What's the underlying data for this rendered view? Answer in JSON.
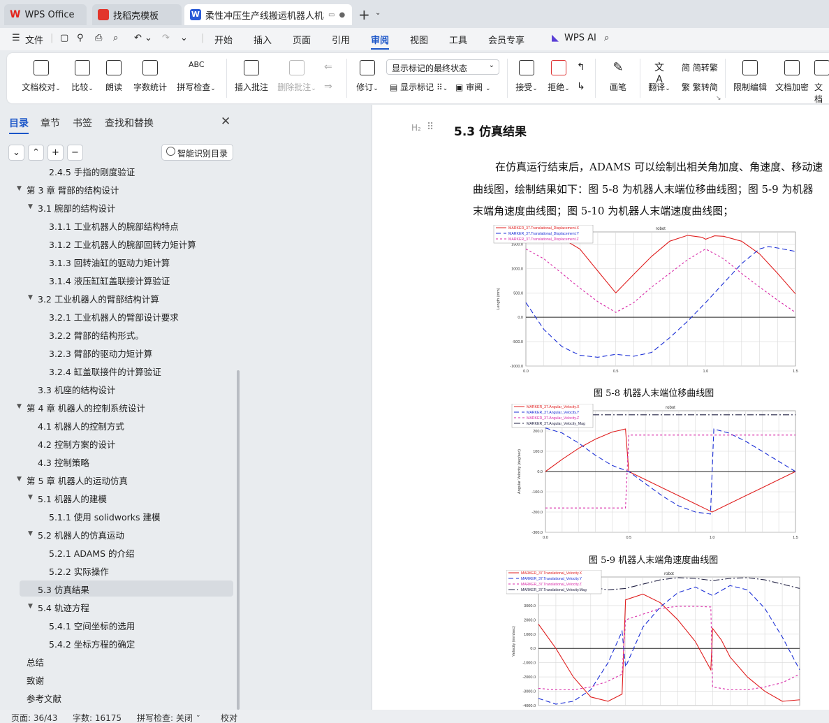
{
  "tabs": {
    "wps": "WPS Office",
    "daoke": "找稻壳模板",
    "doc": "柔性冲压生产线搬运机器人机械"
  },
  "menu": {
    "file": "文件",
    "items": [
      "开始",
      "插入",
      "页面",
      "引用",
      "审阅",
      "视图",
      "工具",
      "会员专享"
    ],
    "active": "审阅",
    "ai": "WPS AI"
  },
  "ribbon": {
    "proof": "文档校对",
    "compare": "比较",
    "read": "朗读",
    "wordcount": "字数统计",
    "spell": "拼写检查",
    "insert_comment": "插入批注",
    "delete_comment": "删除批注",
    "revise": "修订",
    "show_markup_select": "显示标记的最终状态",
    "show_markup": "显示标记",
    "review": "审阅",
    "accept": "接受",
    "reject": "拒绝",
    "pen": "画笔",
    "translate": "翻译",
    "to_trad": "简转繁",
    "to_simp": "繁转简",
    "restrict": "限制编辑",
    "encrypt": "文档加密",
    "more": "文档"
  },
  "sidebar": {
    "tabs": [
      "目录",
      "章节",
      "书签",
      "查找和替换"
    ],
    "smart_toc": "智能识别目录",
    "toc": [
      {
        "text": "2.4.5 手指的刚度验证",
        "level": 3,
        "tri": false
      },
      {
        "text": "第 3 章   臂部的结构设计",
        "level": 1,
        "tri": true
      },
      {
        "text": "3.1 腕部的结构设计",
        "level": 2,
        "tri": true
      },
      {
        "text": "3.1.1 工业机器人的腕部结构特点",
        "level": 3,
        "tri": false
      },
      {
        "text": "3.1.2 工业机器人的腕部回转力矩计算",
        "level": 3,
        "tri": false
      },
      {
        "text": "3.1.3  回转油缸的驱动力矩计算",
        "level": 3,
        "tri": false
      },
      {
        "text": "3.1.4  液压缸缸盖联接计算验证",
        "level": 3,
        "tri": false
      },
      {
        "text": "3.2  工业机器人的臂部结构计算",
        "level": 2,
        "tri": true
      },
      {
        "text": "3.2.1 工业机器人的臂部设计要求",
        "level": 3,
        "tri": false
      },
      {
        "text": "3.2.2 臂部的结构形式。",
        "level": 3,
        "tri": false
      },
      {
        "text": "3.2.3 臂部的驱动力矩计算",
        "level": 3,
        "tri": false
      },
      {
        "text": "3.2.4 缸盖联接件的计算验证",
        "level": 3,
        "tri": false
      },
      {
        "text": "3.3  机座的结构设计",
        "level": 2,
        "tri": false
      },
      {
        "text": "第 4 章   机器人的控制系统设计",
        "level": 1,
        "tri": true
      },
      {
        "text": "4.1 机器人的控制方式",
        "level": 2,
        "tri": false
      },
      {
        "text": "4.2 控制方案的设计",
        "level": 2,
        "tri": false
      },
      {
        "text": "4.3 控制策略",
        "level": 2,
        "tri": false
      },
      {
        "text": "第 5 章    机器人的运动仿真",
        "level": 1,
        "tri": true
      },
      {
        "text": "5.1 机器人的建模",
        "level": 2,
        "tri": true
      },
      {
        "text": "5.1.1  使用 solidworks 建模",
        "level": 3,
        "tri": false
      },
      {
        "text": "5.2  机器人的仿真运动",
        "level": 2,
        "tri": true
      },
      {
        "text": "5.2.1 ADAMS 的介绍",
        "level": 3,
        "tri": false
      },
      {
        "text": "5.2.2 实际操作",
        "level": 3,
        "tri": false
      },
      {
        "text": "5.3  仿真结果",
        "level": 2,
        "tri": false,
        "selected": true
      },
      {
        "text": "5.4  轨迹方程",
        "level": 2,
        "tri": true
      },
      {
        "text": "5.4.1 空间坐标的选用",
        "level": 3,
        "tri": false
      },
      {
        "text": "5.4.2 坐标方程的确定",
        "level": 3,
        "tri": false
      },
      {
        "text": "总结",
        "level": 1,
        "tri": false
      },
      {
        "text": "致谢",
        "level": 1,
        "tri": false
      },
      {
        "text": "参考文献",
        "level": 1,
        "tri": false
      }
    ]
  },
  "doc": {
    "heading_marker": "H₂",
    "heading": "5.3  仿真结果",
    "para": [
      "在仿真运行结束后，ADAMS 可以绘制出相关角加度、角速度、移动速",
      "曲线图，绘制结果如下：图 5-8 为机器人末端位移曲线图；图 5-9 为机器",
      "末端角速度曲线图；图 5-10 为机器人末端速度曲线图；"
    ],
    "cap1": "图 5-8  机器人末端位移曲线图",
    "cap2": "图 5-9  机器人末端角速度曲线图"
  },
  "status": {
    "page": "页面: 36/43",
    "words": "字数: 16175",
    "spell": "拼写检查: 关闭",
    "proof": "校对"
  },
  "chart_data": [
    {
      "type": "line",
      "title": "robot",
      "ylabel": "Length (mm)",
      "xlim": [
        0,
        1.5
      ],
      "ylim": [
        -1000,
        1750
      ],
      "xticks": [
        "0.0",
        "0.5",
        "1.0",
        "1.5"
      ],
      "yticks": [
        "-1000.0",
        "-500.0",
        "0.0",
        "500.0",
        "1000.0",
        "1500.0"
      ],
      "series": [
        {
          "name": "MARKER_37.Translational_Displacement.X",
          "color": "#e02020",
          "dash": "",
          "x": [
            0,
            0.1,
            0.2,
            0.3,
            0.4,
            0.5,
            0.6,
            0.7,
            0.8,
            0.9,
            0.98,
            1.0,
            1.05,
            1.1,
            1.2,
            1.3,
            1.4,
            1.5
          ],
          "y": [
            1600,
            1680,
            1620,
            1400,
            950,
            500,
            880,
            1250,
            1560,
            1680,
            1640,
            1600,
            1670,
            1660,
            1560,
            1300,
            900,
            480
          ]
        },
        {
          "name": "MARKER_37.Translational_Displacement.Y",
          "color": "#1b2fd6",
          "dash": "7,4",
          "x": [
            0,
            0.1,
            0.2,
            0.3,
            0.4,
            0.5,
            0.6,
            0.7,
            0.8,
            0.9,
            1.0,
            1.1,
            1.2,
            1.3,
            1.35,
            1.4,
            1.5
          ],
          "y": [
            300,
            -250,
            -600,
            -780,
            -820,
            -760,
            -800,
            -720,
            -420,
            -80,
            300,
            700,
            1100,
            1400,
            1450,
            1420,
            1350
          ]
        },
        {
          "name": "MARKER_37.Translational_Displacement.Z",
          "color": "#d82aa8",
          "dash": "3,3",
          "x": [
            0,
            0.1,
            0.2,
            0.3,
            0.4,
            0.5,
            0.6,
            0.7,
            0.8,
            0.9,
            1.0,
            1.1,
            1.2,
            1.3,
            1.4,
            1.5
          ],
          "y": [
            1400,
            1200,
            900,
            600,
            320,
            100,
            300,
            620,
            900,
            1180,
            1400,
            1200,
            900,
            620,
            350,
            100
          ]
        }
      ]
    },
    {
      "type": "line",
      "title": "robot",
      "ylabel": "Angular Velocity (deg/sec)",
      "xlim": [
        0,
        1.5
      ],
      "ylim": [
        -300,
        300
      ],
      "xticks": [
        "0.0",
        "0.5",
        "1.0",
        "1.5"
      ],
      "yticks": [
        "-300.0",
        "-200.0",
        "-100.0",
        "0.0",
        "100.0",
        "200.0"
      ],
      "series": [
        {
          "name": "MARKER_37.Angular_Velocity.X",
          "color": "#e02020",
          "dash": "",
          "x": [
            0,
            0.1,
            0.2,
            0.3,
            0.4,
            0.48,
            0.5,
            0.6,
            0.7,
            0.8,
            0.9,
            1.0,
            1.1,
            1.2,
            1.3,
            1.4,
            1.5
          ],
          "y": [
            0,
            60,
            115,
            160,
            195,
            210,
            0,
            -40,
            -80,
            -120,
            -160,
            -200,
            -160,
            -120,
            -80,
            -40,
            0
          ]
        },
        {
          "name": "MARKER_37.Angular_Velocity.Y",
          "color": "#1b2fd6",
          "dash": "7,4",
          "x": [
            0,
            0.1,
            0.2,
            0.3,
            0.4,
            0.5,
            0.6,
            0.7,
            0.8,
            0.9,
            0.99,
            1.0,
            1.01,
            1.1,
            1.2,
            1.3,
            1.4,
            1.5
          ],
          "y": [
            215,
            190,
            140,
            80,
            30,
            0,
            -60,
            -120,
            -170,
            -200,
            -210,
            0,
            210,
            190,
            150,
            100,
            50,
            0
          ]
        },
        {
          "name": "MARKER_37.Angular_Velocity.Z",
          "color": "#d82aa8",
          "dash": "3,3",
          "x": [
            0,
            0.48,
            0.5,
            1.5
          ],
          "y": [
            -180,
            -180,
            180,
            180
          ]
        },
        {
          "name": "MARKER_37.Angular_Velocity_Mag",
          "color": "#222244",
          "dash": "9,3,2,3",
          "x": [
            0,
            1.5
          ],
          "y": [
            280,
            280
          ]
        }
      ]
    },
    {
      "type": "line",
      "title": "robot",
      "ylabel": "Velocity (mm/sec)",
      "xlim": [
        0,
        1.5
      ],
      "ylim": [
        -4000,
        5000
      ],
      "xticks": [],
      "yticks": [
        "-4000.0",
        "-3000.0",
        "-2000.0",
        "-1000.0",
        "0.0",
        "1000.0",
        "2000.0",
        "3000.0"
      ],
      "series": [
        {
          "name": "MARKER_37.Translational_Velocity.X",
          "color": "#e02020",
          "dash": "",
          "x": [
            0,
            0.1,
            0.2,
            0.3,
            0.4,
            0.48,
            0.5,
            0.6,
            0.7,
            0.8,
            0.9,
            0.99,
            1.0,
            1.05,
            1.1,
            1.2,
            1.3,
            1.4,
            1.5
          ],
          "y": [
            1700,
            0,
            -2000,
            -3400,
            -3700,
            -3200,
            3400,
            3800,
            3200,
            2000,
            500,
            -1500,
            1400,
            600,
            -600,
            -2000,
            -3000,
            -3700,
            -3600
          ]
        },
        {
          "name": "MARKER_37.Translational_Velocity.Y",
          "color": "#1b2fd6",
          "dash": "7,4",
          "x": [
            0,
            0.1,
            0.2,
            0.3,
            0.4,
            0.48,
            0.5,
            0.6,
            0.7,
            0.8,
            0.9,
            1.0,
            1.1,
            1.2,
            1.3,
            1.4,
            1.5
          ],
          "y": [
            -3500,
            -3900,
            -3700,
            -2900,
            -1000,
            1200,
            -1300,
            1500,
            2900,
            3900,
            4300,
            3700,
            4400,
            4100,
            2800,
            800,
            -1500
          ]
        },
        {
          "name": "MARKER_37.Translational_Velocity.Z",
          "color": "#d82aa8",
          "dash": "3,3",
          "x": [
            0,
            0.1,
            0.2,
            0.3,
            0.4,
            0.48,
            0.5,
            0.6,
            0.7,
            0.8,
            0.9,
            0.99,
            1.0,
            1.1,
            1.2,
            1.3,
            1.4,
            1.5
          ],
          "y": [
            -2800,
            -2900,
            -2900,
            -2700,
            -2300,
            -1800,
            2000,
            2400,
            2800,
            2950,
            2950,
            2900,
            -2700,
            -2900,
            -2900,
            -2700,
            -2400,
            -1800
          ]
        },
        {
          "name": "MARKER_37.Translational_Velocity.Mag",
          "color": "#222244",
          "dash": "9,3,2,3",
          "x": [
            0,
            0.1,
            0.2,
            0.3,
            0.4,
            0.5,
            0.6,
            0.7,
            0.8,
            0.9,
            1.0,
            1.1,
            1.2,
            1.3,
            1.4,
            1.5
          ],
          "y": [
            4700,
            4950,
            4700,
            4300,
            4100,
            4200,
            4500,
            4800,
            4950,
            4900,
            4750,
            4900,
            4950,
            4800,
            4500,
            4200
          ]
        }
      ]
    }
  ]
}
